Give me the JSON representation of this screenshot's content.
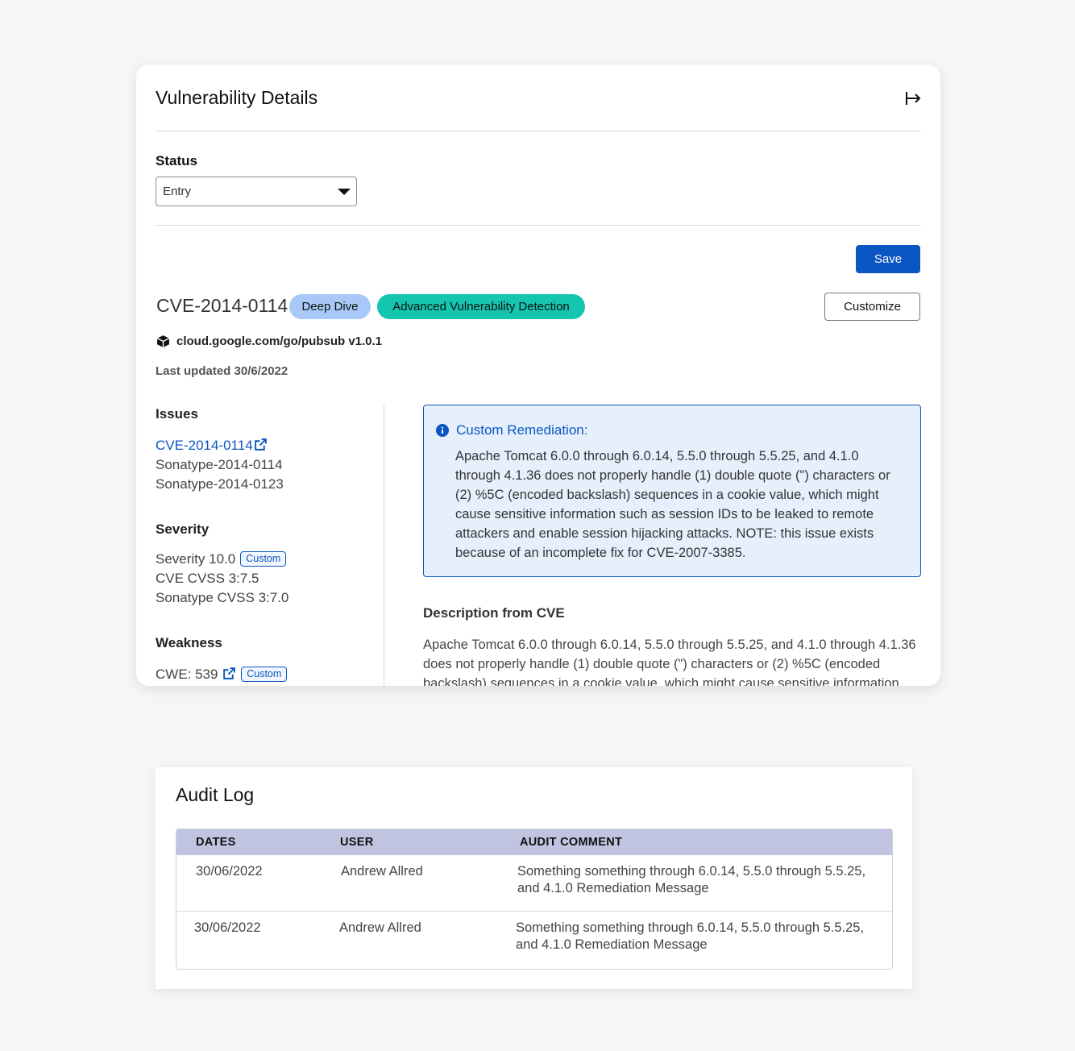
{
  "details": {
    "title": "Vulnerability Details",
    "status_label": "Status",
    "status_value": "Entry",
    "save_label": "Save",
    "customize_label": "Customize",
    "cve_id": "CVE-2014-0114",
    "badges": [
      "Deep Dive",
      "Advanced Vulnerability Detection"
    ],
    "package": "cloud.google.com/go/pubsub v1.0.1",
    "last_updated": "Last updated 30/6/2022",
    "issues": {
      "heading": "Issues",
      "items": [
        "CVE-2014-0114",
        "Sonatype-2014-0114",
        "Sonatype-2014-0123"
      ]
    },
    "severity": {
      "heading": "Severity",
      "items": [
        "Severity 10.0",
        "CVE CVSS 3:7.5",
        "Sonatype CVSS 3:7.0"
      ],
      "custom_tag": "Custom"
    },
    "weakness": {
      "heading": "Weakness",
      "cwe": "CWE: 539",
      "custom_tag": "Custom"
    },
    "remediation": {
      "title": "Custom Remediation:",
      "body": "Apache Tomcat 6.0.0 through 6.0.14, 5.5.0 through 5.5.25, and 4.1.0 through 4.1.36 does not properly handle (1) double quote (\") characters or (2) %5C (encoded backslash) sequences in a cookie value, which might cause sensitive information such as session IDs to be leaked to remote attackers and enable session hijacking attacks. NOTE: this issue exists because of an incomplete fix for CVE-2007-3385."
    },
    "description": {
      "heading": "Description from CVE",
      "body": "Apache Tomcat 6.0.0 through 6.0.14, 5.5.0 through 5.5.25, and 4.1.0 through 4.1.36 does not properly handle (1) double quote (\") characters or (2) %5C (encoded backslash) sequences in a cookie value, which might cause sensitive information"
    },
    "colors": {
      "accent": "#0a56c2",
      "deep_dive_badge": "#a8c8f8",
      "avd_badge": "#14c6b0",
      "remediation_bg": "#e6f0fc"
    }
  },
  "audit": {
    "title": "Audit Log",
    "columns": [
      "DATES",
      "USER",
      "AUDIT COMMENT"
    ],
    "rows": [
      {
        "date": "30/06/2022",
        "user": "Andrew Allred",
        "comment": "Something something through 6.0.14, 5.5.0 through 5.5.25, and 4.1.0 Remediation Message"
      },
      {
        "date": "30/06/2022",
        "user": "Andrew Allred",
        "comment": "Something something through 6.0.14, 5.5.0 through 5.5.25, and 4.1.0 Remediation Message"
      }
    ],
    "colors": {
      "header_bg": "#c0c4e0"
    }
  }
}
